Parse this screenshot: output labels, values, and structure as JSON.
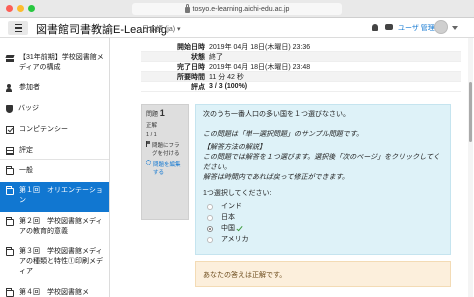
{
  "browser": {
    "url": "tosyo.e-learning.aichi-edu.ac.jp"
  },
  "navbar": {
    "site_title": "図書館司書教諭E-Learning",
    "language": "日本語 (ja) ▾",
    "user_name": "ユーザ 管理"
  },
  "drawer": {
    "items": [
      {
        "label": "【31年前期】学校図書館メディアの構成",
        "icon": "graduation-cap-icon"
      },
      {
        "label": "参加者",
        "icon": "users-icon"
      },
      {
        "label": "バッジ",
        "icon": "shield-icon"
      },
      {
        "label": "コンピテンシー",
        "icon": "check-square-icon"
      },
      {
        "label": "評定",
        "icon": "table-icon"
      },
      {
        "label": "一般",
        "icon": "folder-icon"
      },
      {
        "label": "第１回　オリエンテーション",
        "icon": "folder-icon",
        "active": true
      },
      {
        "label": "第２回　学校図書館メディアの教育的意義",
        "icon": "folder-icon"
      },
      {
        "label": "第３回　学校図書館メディアの種類と特性①印刷メディア",
        "icon": "folder-icon"
      },
      {
        "label": "第４回　学校図書館メ",
        "icon": "folder-icon"
      }
    ]
  },
  "summary": {
    "rows": [
      {
        "label": "開始日時",
        "value": "2019年 04月 18日(木曜日) 23:36"
      },
      {
        "label": "状態",
        "value": "終了"
      },
      {
        "label": "完了日時",
        "value": "2019年 04月 18日(木曜日) 23:48"
      },
      {
        "label": "所要時間",
        "value": "11 分 42 秒"
      },
      {
        "label": "評点",
        "value": "3 / 3 (100%)"
      }
    ]
  },
  "question_info": {
    "label": "問題",
    "number": "1",
    "state": "正解",
    "mark": "1 / 1",
    "flag_label": "問題にフラグを付ける",
    "edit_label": "問題を編集する"
  },
  "question": {
    "text_1": "次のうち一番人口の多い国を１つ選びなさい。",
    "text_2": "この問題は「単一選択問題」のサンプル問題です。",
    "text_3": "【解答方法の解説】",
    "text_4": "この問題では解答を１つ選びます。選択後「次のページ」をクリックしてください。",
    "text_5": "解答は時間内であれば戻って修正ができます。",
    "prompt": "1つ選択してください:",
    "options": [
      {
        "label": "インド",
        "selected": false
      },
      {
        "label": "日本",
        "selected": false
      },
      {
        "label": "中国",
        "selected": true,
        "correct": true
      },
      {
        "label": "アメリカ",
        "selected": false
      }
    ]
  },
  "outcome": {
    "text": "あなたの答えは正解です。"
  },
  "colors": {
    "accent": "#1177d1",
    "question_bg": "#def2f8",
    "outcome_bg": "#fcefdc",
    "correct": "#3c9a3c"
  }
}
